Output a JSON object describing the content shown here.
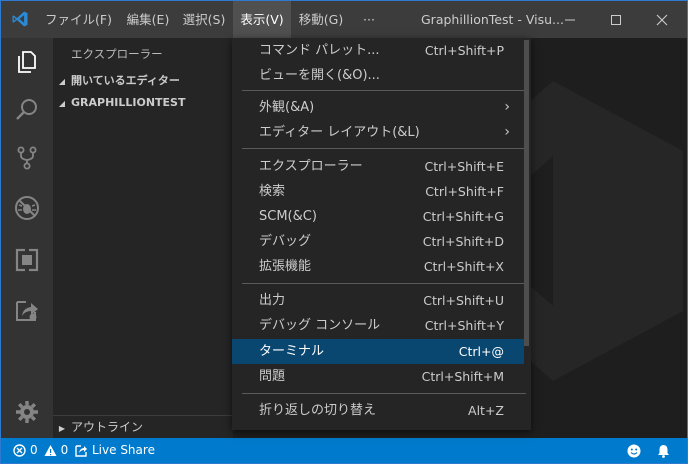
{
  "titlebar": {
    "menus": [
      "ファイル(F)",
      "編集(E)",
      "選択(S)",
      "表示(V)",
      "移動(G)",
      "···"
    ],
    "window_title": "GraphillionTest - Visu..."
  },
  "sidebar": {
    "title": "エクスプローラー",
    "sections": [
      "開いているエディター",
      "GRAPHILLIONTEST"
    ],
    "outline": "アウトライン"
  },
  "view_menu": {
    "items": [
      {
        "label": "コマンド パレット...",
        "shortcut": "Ctrl+Shift+P"
      },
      {
        "label": "ビューを開く(&O)...",
        "shortcut": ""
      },
      {
        "label": "外観(&A)",
        "shortcut": ""
      },
      {
        "label": "エディター レイアウト(&L)",
        "shortcut": ""
      },
      {
        "label": "エクスプローラー",
        "shortcut": "Ctrl+Shift+E"
      },
      {
        "label": "検索",
        "shortcut": "Ctrl+Shift+F"
      },
      {
        "label": "SCM(&C)",
        "shortcut": "Ctrl+Shift+G"
      },
      {
        "label": "デバッグ",
        "shortcut": "Ctrl+Shift+D"
      },
      {
        "label": "拡張機能",
        "shortcut": "Ctrl+Shift+X"
      },
      {
        "label": "出力",
        "shortcut": "Ctrl+Shift+U"
      },
      {
        "label": "デバッグ コンソール",
        "shortcut": "Ctrl+Shift+Y"
      },
      {
        "label": "ターミナル",
        "shortcut": "Ctrl+@"
      },
      {
        "label": "問題",
        "shortcut": "Ctrl+Shift+M"
      },
      {
        "label": "折り返しの切り替え",
        "shortcut": "Alt+Z"
      }
    ]
  },
  "statusbar": {
    "errors": "0",
    "warnings": "0",
    "live_share": "Live Share"
  },
  "colors": {
    "accent": "#007acc",
    "selection": "#094771"
  }
}
